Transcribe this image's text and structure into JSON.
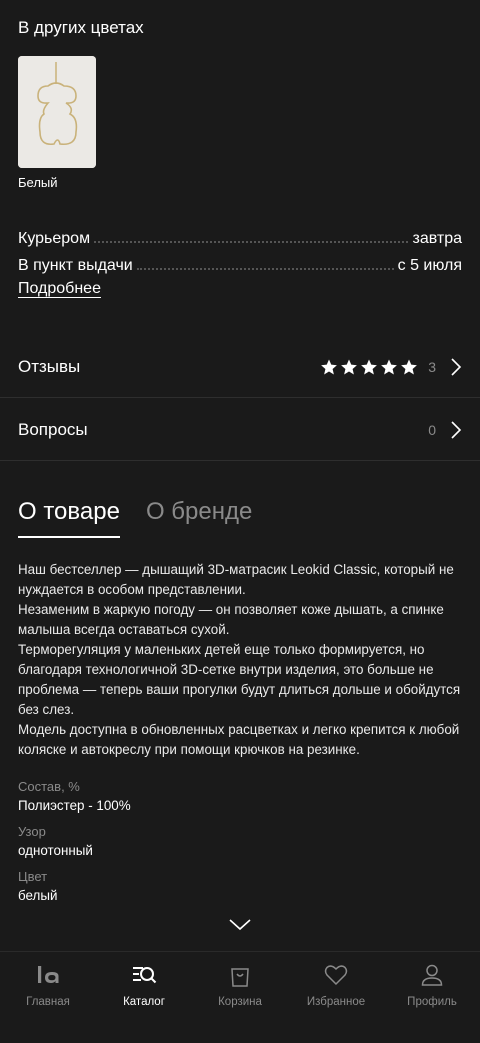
{
  "colors": {
    "title": "В других цветах",
    "items": [
      {
        "label": "Белый"
      }
    ]
  },
  "delivery": {
    "rows": [
      {
        "method": "Курьером",
        "when": "завтра"
      },
      {
        "method": "В пункт выдачи",
        "when": "с 5 июля"
      }
    ],
    "more_link": "Подробнее"
  },
  "reviews": {
    "label": "Отзывы",
    "rating": 5,
    "count": "3"
  },
  "questions": {
    "label": "Вопросы",
    "count": "0"
  },
  "info_tabs": [
    {
      "label": "О товаре",
      "active": true
    },
    {
      "label": "О бренде",
      "active": false
    }
  ],
  "description": [
    "Наш бестселлер — дышащий 3D-матрасик Leokid Classic, который не нуждается в особом представлении.",
    "Незаменим в жаркую погоду — он позволяет коже дышать, а спинке малыша всегда оставаться сухой.",
    "Терморегуляция у маленьких детей еще только формируется, но благодаря технологичной 3D-сетке внутри изделия, это больше не проблема — теперь ваши прогулки будут длиться дольше и обойдутся без слез.",
    "Модель доступна в обновленных расцветках и легко крепится к любой коляске и автокреслу при помощи крючков на резинке."
  ],
  "attributes": [
    {
      "key": "Состав, %",
      "value": "Полиэстер - 100%"
    },
    {
      "key": "Узор",
      "value": "однотонный"
    },
    {
      "key": "Цвет",
      "value": "белый"
    }
  ],
  "tabbar": [
    {
      "label": "Главная",
      "icon": "home-logo-icon",
      "active": false
    },
    {
      "label": "Каталог",
      "icon": "catalog-search-icon",
      "active": true
    },
    {
      "label": "Корзина",
      "icon": "bag-icon",
      "active": false
    },
    {
      "label": "Избранное",
      "icon": "heart-icon",
      "active": false
    },
    {
      "label": "Профиль",
      "icon": "profile-icon",
      "active": false
    }
  ]
}
